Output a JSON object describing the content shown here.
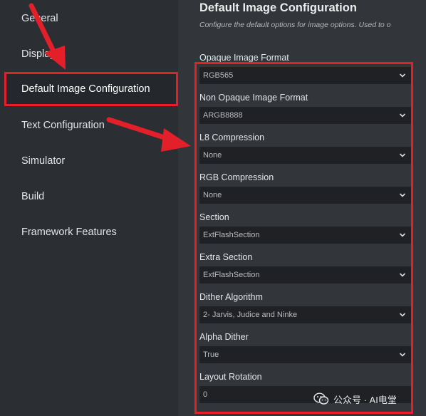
{
  "sidebar": {
    "items": [
      {
        "label": "General"
      },
      {
        "label": "Display"
      },
      {
        "label": "Default Image Configuration"
      },
      {
        "label": "Text Configuration"
      },
      {
        "label": "Simulator"
      },
      {
        "label": "Build"
      },
      {
        "label": "Framework Features"
      }
    ]
  },
  "main": {
    "title": "Default Image Configuration",
    "subtitle": "Configure the default options for image options. Used to o",
    "fields": [
      {
        "label": "Opaque Image Format",
        "value": "RGB565"
      },
      {
        "label": "Non Opaque Image Format",
        "value": "ARGB8888"
      },
      {
        "label": "L8 Compression",
        "value": "None"
      },
      {
        "label": "RGB Compression",
        "value": "None"
      },
      {
        "label": "Section",
        "value": "ExtFlashSection"
      },
      {
        "label": "Extra Section",
        "value": "ExtFlashSection"
      },
      {
        "label": "Dither Algorithm",
        "value": "2- Jarvis, Judice and Ninke"
      },
      {
        "label": "Alpha Dither",
        "value": "True"
      },
      {
        "label": "Layout Rotation",
        "value": "0"
      }
    ]
  },
  "watermark": {
    "text": "公众号 · AI电堂"
  },
  "colors": {
    "highlight": "#e3202a",
    "sidebar": "#2b2e32",
    "panel": "#323539",
    "field": "#1f2124"
  }
}
